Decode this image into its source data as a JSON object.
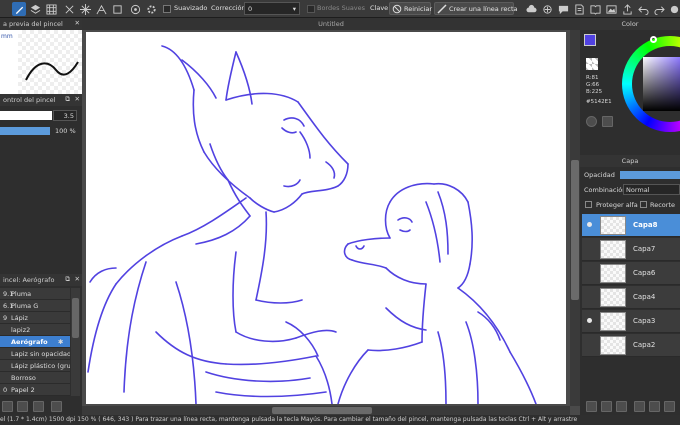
{
  "toolbar": {
    "smoothing_label": "Suavizado",
    "correction_label": "Corrección",
    "correction_value": "0",
    "soft_edges_label": "Bordes Suaves",
    "key_label": "Clave",
    "reset_label": "Reiniciar",
    "create_line_label": "Crear una línea recta"
  },
  "canvas": {
    "title": "Untitled"
  },
  "brush_preview": {
    "title": "a previa del pincel",
    "size_text": "mm"
  },
  "brush_control": {
    "title": "ontrol del pincel",
    "size_value": "3.5",
    "opacity_value": "100 %",
    "opacity_percent": 100
  },
  "brush_list": {
    "title": "incel: Aerógrafo",
    "items": [
      {
        "num": "9.1",
        "label": "Pluma"
      },
      {
        "num": "6.1",
        "label": "Pluma G"
      },
      {
        "num": "9",
        "label": "Lápiz"
      },
      {
        "num": "",
        "label": "lapiz2"
      },
      {
        "num": "",
        "label": "Aerógrafo"
      },
      {
        "num": "",
        "label": "Lapiz sin opacidad"
      },
      {
        "num": "",
        "label": "Lápiz plástico (gru"
      },
      {
        "num": "",
        "label": "Borroso"
      },
      {
        "num": "0",
        "label": "Papel 2"
      }
    ],
    "selected_index": 4
  },
  "color_panel": {
    "title": "Color",
    "r_label": "R:81",
    "g_label": "G:66",
    "b_label": "B:225",
    "hex_label": "#5142E1",
    "main_color": "#5142E1",
    "secondary_color": "#c2185b"
  },
  "layer_panel": {
    "title": "Capa",
    "opacity_label": "Opacidad",
    "blend_label": "Combinación",
    "blend_value": "Normal",
    "protect_alpha_label": "Proteger alfa",
    "clip_label": "Recorte",
    "layers": [
      {
        "name": "Capa8",
        "visible": true,
        "selected": true
      },
      {
        "name": "Capa7",
        "visible": false,
        "selected": false
      },
      {
        "name": "Capa6",
        "visible": false,
        "selected": false
      },
      {
        "name": "Capa4",
        "visible": false,
        "selected": false
      },
      {
        "name": "Capa3",
        "visible": true,
        "selected": false
      },
      {
        "name": "Capa2",
        "visible": false,
        "selected": false
      }
    ]
  },
  "status": {
    "text": "el   (1.7 * 1.4cm)   1500 dpi   150 %   ( 646, 343 )   Para trazar una línea recta, mantenga pulsada la tecla Mayús. Para cambiar el tamaño del pincel, mantenga pulsada las teclas Ctrl + Alt y arrastre"
  },
  "colors": {
    "accent": "#4a90d9",
    "line_color": "#5142E1",
    "selected_row": "#3d7fd0"
  }
}
